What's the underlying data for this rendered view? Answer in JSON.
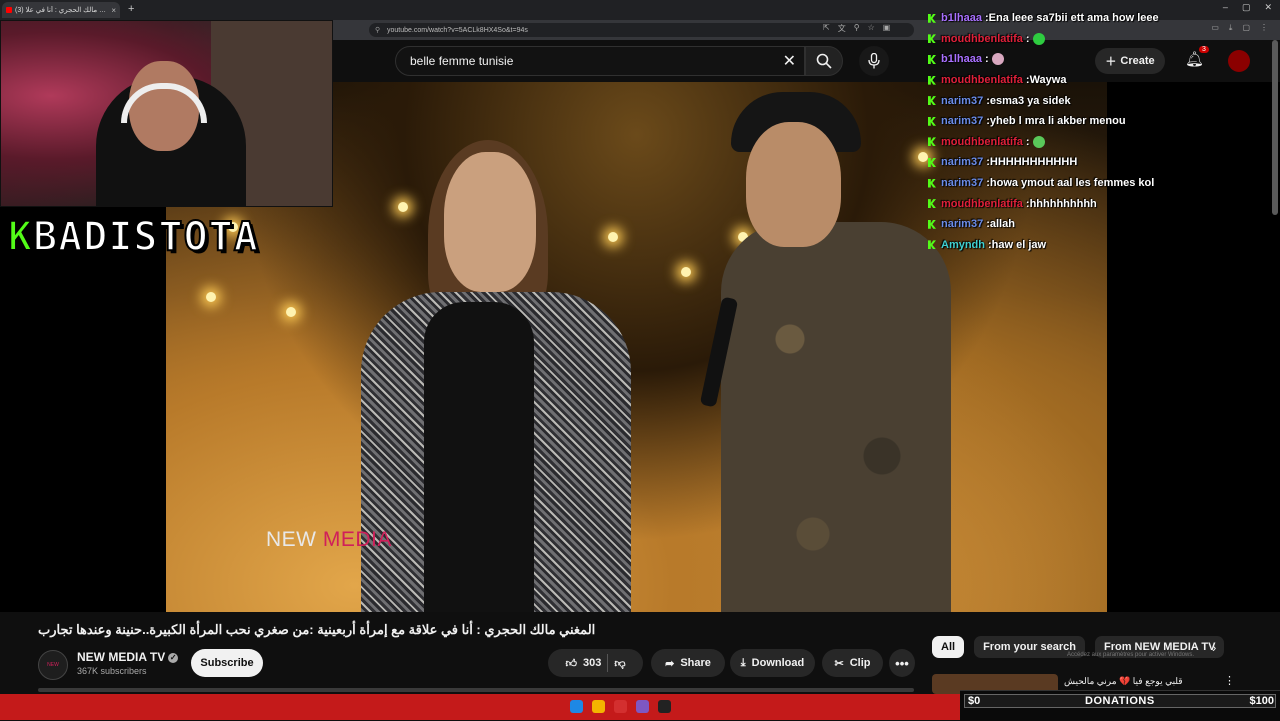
{
  "browser": {
    "tab_title": "(3) المغني مالك الحجري : أنا في علا",
    "new_tab": "+",
    "tab_close": "×",
    "url": "youtube.com/watch?v=5ACLk8HX4So&t=94s",
    "window_controls": [
      "–",
      "▢",
      "✕"
    ]
  },
  "youtube": {
    "search_value": "belle femme tunisie",
    "create_label": "Create",
    "notification_count": "3"
  },
  "overlay": {
    "streamer_initial": "K",
    "streamer_name": "BADISTOTA",
    "watermark_a": "NEW ",
    "watermark_b": "MEDIA"
  },
  "chat": [
    {
      "user": "b1lhaaa",
      "message": "Ena leee sa7bii ett ama how leee",
      "color": "#a970ff"
    },
    {
      "user": "moudhbenlatifa",
      "message": "",
      "emote": "#2ecc40",
      "color": "#e0203a"
    },
    {
      "user": "b1lhaaa",
      "message": "",
      "emote": "#d9a8c0",
      "color": "#a970ff"
    },
    {
      "user": "moudhbenlatifa",
      "message": "Waywa",
      "color": "#e0203a"
    },
    {
      "user": "narim37",
      "message": "esma3 ya sidek",
      "color": "#6b8ce8"
    },
    {
      "user": "narim37",
      "message": "yheb l mra li akber menou",
      "color": "#6b8ce8"
    },
    {
      "user": "moudhbenlatifa",
      "message": "",
      "emote": "#5ac85a",
      "color": "#e0203a"
    },
    {
      "user": "narim37",
      "message": "HHHHHHHHHHH",
      "color": "#6b8ce8"
    },
    {
      "user": "narim37",
      "message": "howa ymout aal les femmes kol",
      "color": "#6b8ce8"
    },
    {
      "user": "moudhbenlatifa",
      "message": "hhhhhhhhhh",
      "color": "#e0203a"
    },
    {
      "user": "narim37",
      "message": "allah",
      "color": "#6b8ce8"
    },
    {
      "user": "Amyndh",
      "message": "haw el jaw",
      "color": "#3fd0d0"
    }
  ],
  "video": {
    "title": "المغني مالك الحجري : أنا في علاقة مع إمرأة أربعينية :من صغري نحب المرأة الكبيرة..حنينة وعندها تجارب",
    "channel_name": "NEW MEDIA TV",
    "subscribers": "367K subscribers",
    "subscribe_label": "Subscribe",
    "likes": "303",
    "share_label": "Share",
    "download_label": "Download",
    "clip_label": "Clip"
  },
  "sidebar": {
    "chips": [
      "All",
      "From your search",
      "From NEW MEDIA TV"
    ],
    "rec_title": "قلبي يوجع فيا 💔 مرني مالحيش",
    "activate_text": "Accédez aux paramètres pour activer Windows."
  },
  "donations": {
    "low": "$0",
    "label": "DONATIONS",
    "high": "$100",
    "progress": 0
  }
}
